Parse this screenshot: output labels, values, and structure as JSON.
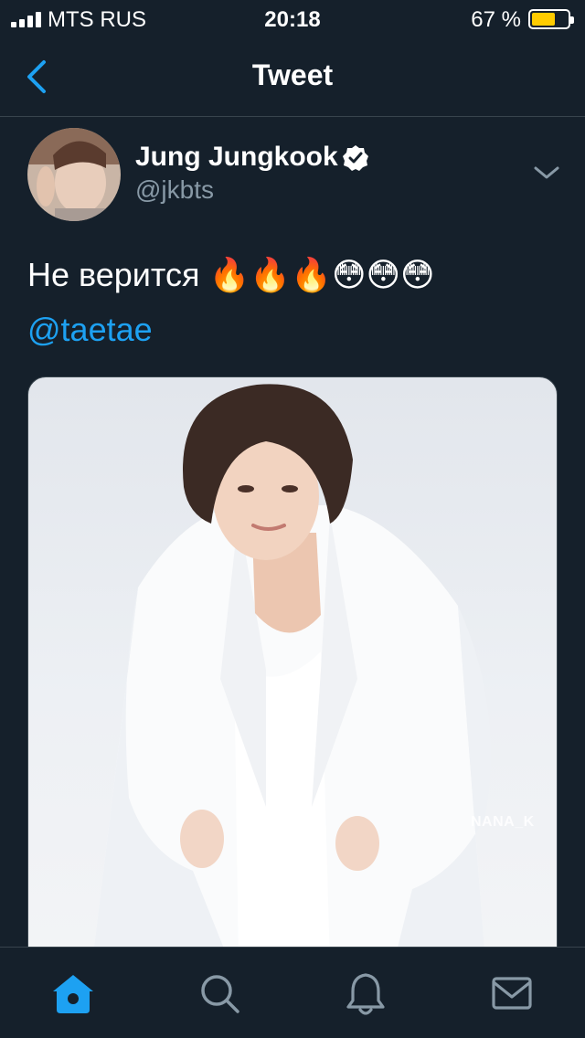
{
  "status_bar": {
    "carrier": "MTS RUS",
    "time": "20:18",
    "battery_percent_label": "67 %",
    "battery_level": 0.67
  },
  "nav": {
    "title": "Tweet"
  },
  "tweet": {
    "display_name": "Jung Jungkook",
    "handle": "@jkbts",
    "text": "Не верится 🔥🔥🔥😳😳😳",
    "mention": "@taetae",
    "media_watermark": "NANA_K"
  },
  "tab_bar": {
    "items": [
      {
        "icon": "home-icon",
        "active": true
      },
      {
        "icon": "search-icon",
        "active": false
      },
      {
        "icon": "bell-icon",
        "active": false
      },
      {
        "icon": "mail-icon",
        "active": false
      }
    ]
  },
  "colors": {
    "background": "#15202b",
    "accent": "#1da1f2",
    "secondary_text": "#8899a6",
    "divider": "#38444d",
    "battery": "#ffcc00"
  }
}
